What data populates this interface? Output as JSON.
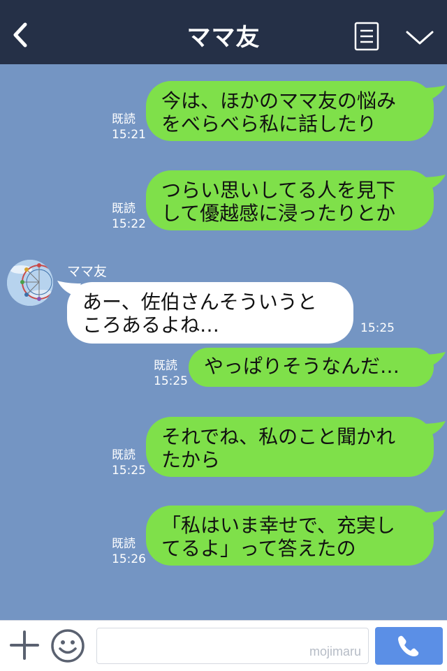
{
  "header": {
    "title": "ママ友",
    "back_icon": "chevron-left-icon",
    "menu_icon": "list-icon",
    "collapse_icon": "chevron-down-icon"
  },
  "chat": {
    "sender_name": "ママ友",
    "messages": [
      {
        "dir": "out",
        "lines": [
          "今は、ほかのママ友の悩み",
          "をべらべら私に話したり"
        ],
        "read": "既読",
        "time": "15:21"
      },
      {
        "dir": "out",
        "lines": [
          "つらい思いしてる人を見下",
          "して優越感に浸ったりとか"
        ],
        "read": "既読",
        "time": "15:22"
      },
      {
        "dir": "in",
        "lines": [
          "あー、佐伯さんそういうと",
          "ころあるよね…"
        ],
        "time": "15:25"
      },
      {
        "dir": "out",
        "lines": [
          "やっぱりそうなんだ…"
        ],
        "read": "既読",
        "time": "15:25"
      },
      {
        "dir": "out",
        "lines": [
          "それでね、私のこと聞かれ",
          "たから"
        ],
        "read": "既読",
        "time": "15:25"
      },
      {
        "dir": "out",
        "lines": [
          "「私はいま幸せで、充実し",
          "てるよ」って答えたの"
        ],
        "read": "既読",
        "time": "15:26"
      }
    ]
  },
  "input_bar": {
    "placeholder": "",
    "watermark": "mojimaru",
    "plus_icon": "plus-icon",
    "sticker_icon": "smile-icon",
    "call_icon": "phone-icon"
  },
  "colors": {
    "header_bg": "#253047",
    "chat_bg": "#7495c3",
    "outgoing_bubble": "#7fe04a",
    "incoming_bubble": "#ffffff",
    "call_button": "#5b8fe6"
  }
}
